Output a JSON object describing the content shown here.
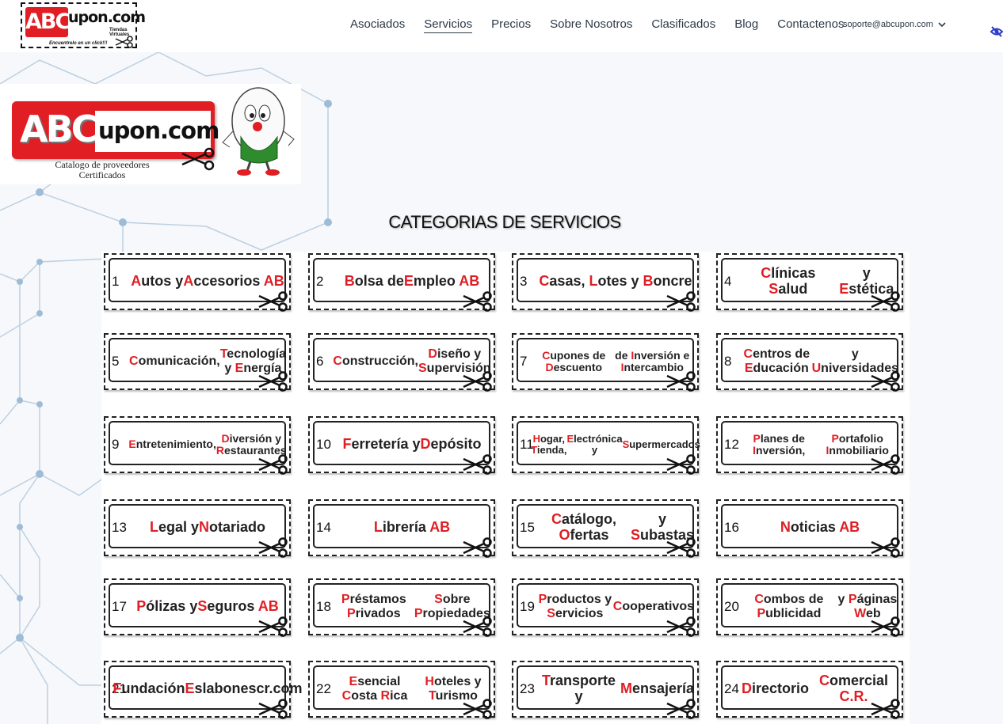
{
  "nav": {
    "logo_main": "ABC",
    "logo_sub": "upon.com",
    "logo_tagline_small": "Tiendas Virtuales",
    "logo_slogan": "Encuentrelo en un click!!!",
    "links": [
      {
        "label": "Asociados",
        "active": false
      },
      {
        "label": "Servicios",
        "active": true
      },
      {
        "label": "Precios",
        "active": false
      },
      {
        "label": "Sobre Nosotros",
        "active": false
      },
      {
        "label": "Clasificados",
        "active": false
      },
      {
        "label": "Blog",
        "active": false
      },
      {
        "label": "Contactenos",
        "active": false
      }
    ],
    "user_email": "soporte@abcupon.com",
    "accent_color": "#2a3cc8"
  },
  "banner": {
    "logo_main": "ABC",
    "logo_sub": "upon.com",
    "caption_line1": "Catalogo de proveedores",
    "caption_line2": "Certificados"
  },
  "title": "CATEGORIAS DE SERVICIOS",
  "brand_red": "#e01e24",
  "categories": [
    {
      "num": "1",
      "label": "Autos y\nAccesorios AB"
    },
    {
      "num": "2",
      "label": "Bolsa de\nEmpleo AB"
    },
    {
      "num": "3",
      "label": "Casas, Lotes y Boncre"
    },
    {
      "num": "4",
      "label": "Clínicas Salud\ny Estética"
    },
    {
      "num": "5",
      "label": "Comunicación,\nTecnología y Energía"
    },
    {
      "num": "6",
      "label": "Construcción,\nDiseño y Supervisión"
    },
    {
      "num": "7",
      "label": "Cupones de Descuento\nde Inversión e Intercambio"
    },
    {
      "num": "8",
      "label": "Centros de Educación\ny Universidades"
    },
    {
      "num": "9",
      "label": "Entretenimiento,\nDiversión y Restaurantes"
    },
    {
      "num": "10",
      "label": "Ferretería y\nDepósito"
    },
    {
      "num": "11",
      "label": "Hogar, Tienda,\nElectrónica y\nSupermercados"
    },
    {
      "num": "12",
      "label": "Planes de Inversión,\nPortafolio Inmobiliario"
    },
    {
      "num": "13",
      "label": "Legal y\nNotariado"
    },
    {
      "num": "14",
      "label": "Librería AB"
    },
    {
      "num": "15",
      "label": "Catálogo, Ofertas\ny Subastas"
    },
    {
      "num": "16",
      "label": "Noticias AB"
    },
    {
      "num": "17",
      "label": "Pólizas y\nSeguros AB"
    },
    {
      "num": "18",
      "label": "Préstamos Privados\nSobre Propiedades"
    },
    {
      "num": "19",
      "label": "Productos y Servicios\nCooperativos"
    },
    {
      "num": "20",
      "label": "Combos de Publicidad\ny Páginas Web"
    },
    {
      "num": "21",
      "label": "Fundación\nEslabonescr.com"
    },
    {
      "num": "22",
      "label": "Esencial Costa Rica\nHoteles y Turismo"
    },
    {
      "num": "23",
      "label": "Transporte y\nMensajería"
    },
    {
      "num": "24",
      "label": "Directorio\nComercial C.R."
    }
  ]
}
